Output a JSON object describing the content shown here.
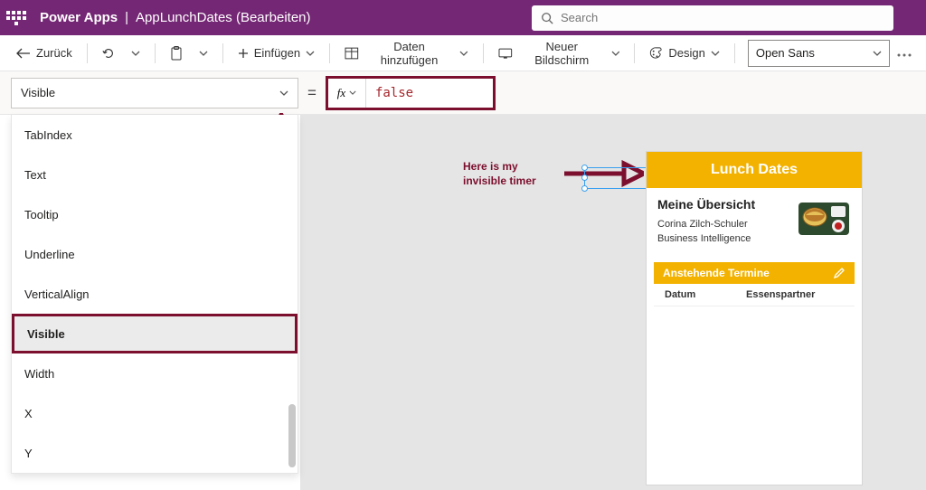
{
  "title": {
    "brand": "Power Apps",
    "pipe": "|",
    "doc": "AppLunchDates (Bearbeiten)"
  },
  "search": {
    "placeholder": "Search"
  },
  "cmd": {
    "back": "Zurück",
    "insert": "Einfügen",
    "adddata": "Daten hinzufügen",
    "newscreen": "Neuer Bildschirm",
    "design": "Design",
    "font": "Open Sans"
  },
  "formula": {
    "property": "Visible",
    "equals": "=",
    "fx": "fx",
    "value": "false"
  },
  "properties": {
    "items": [
      "TabIndex",
      "Text",
      "Tooltip",
      "Underline",
      "VerticalAlign",
      "Visible",
      "Width",
      "X",
      "Y"
    ],
    "selectedIndex": 5
  },
  "annotation": {
    "text1": "Here is my",
    "text2": "invisible timer"
  },
  "phone": {
    "title": "Lunch Dates",
    "overview": "Meine Übersicht",
    "user": "Corina Zilch-Schuler",
    "role": "Business Intelligence",
    "table_title": "Anstehende Termine",
    "col1": "Datum",
    "col2": "Essenspartner"
  }
}
